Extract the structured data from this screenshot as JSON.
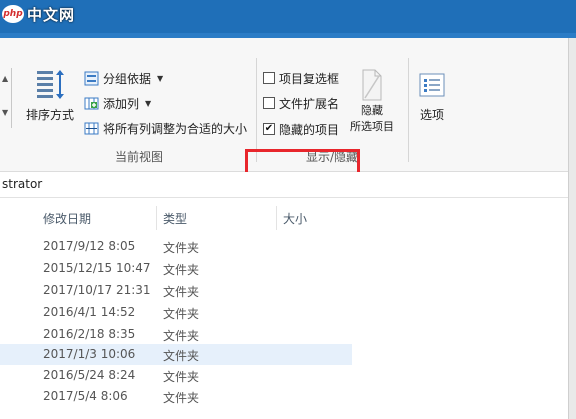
{
  "watermark": {
    "logo_text": "php",
    "site_text": "中文网"
  },
  "ribbon": {
    "left_control": {
      "up": "▲",
      "down": "▼"
    },
    "current_view": {
      "sort_label": "排序方式",
      "group_by_label": "分组依据",
      "add_column_label": "添加列",
      "fit_columns_label": "将所有列调整为合适的大小",
      "group_label": "当前视图"
    },
    "show_hide": {
      "item_checkboxes_label": "项目复选框",
      "file_extensions_label": "文件扩展名",
      "hidden_items_label": "隐藏的项目",
      "hide_label": "隐藏",
      "selected_items_label": "所选项目",
      "group_label": "显示/隐藏",
      "item_checkboxes_checked": false,
      "file_extensions_checked": false,
      "hidden_items_checked": true
    },
    "options_label": "选项"
  },
  "address": {
    "text": "strator"
  },
  "columns": {
    "date": "修改日期",
    "type": "类型",
    "size": "大小"
  },
  "files": [
    {
      "date": "2017/9/12 8:05",
      "type": "文件夹"
    },
    {
      "date": "2015/12/15 10:47",
      "type": "文件夹"
    },
    {
      "date": "2017/10/17 21:31",
      "type": "文件夹"
    },
    {
      "date": "2016/4/1 14:52",
      "type": "文件夹"
    },
    {
      "date": "2016/2/18 8:35",
      "type": "文件夹"
    },
    {
      "date": "2017/1/3 10:06",
      "type": "文件夹",
      "selected": true
    },
    {
      "date": "2016/5/24 8:24",
      "type": "文件夹"
    },
    {
      "date": "2017/5/4 8:06",
      "type": "文件夹"
    }
  ],
  "colors": {
    "highlight": "#e8262c",
    "titlebar": "#1f6fb8",
    "selected_row": "#e6f0fb"
  }
}
